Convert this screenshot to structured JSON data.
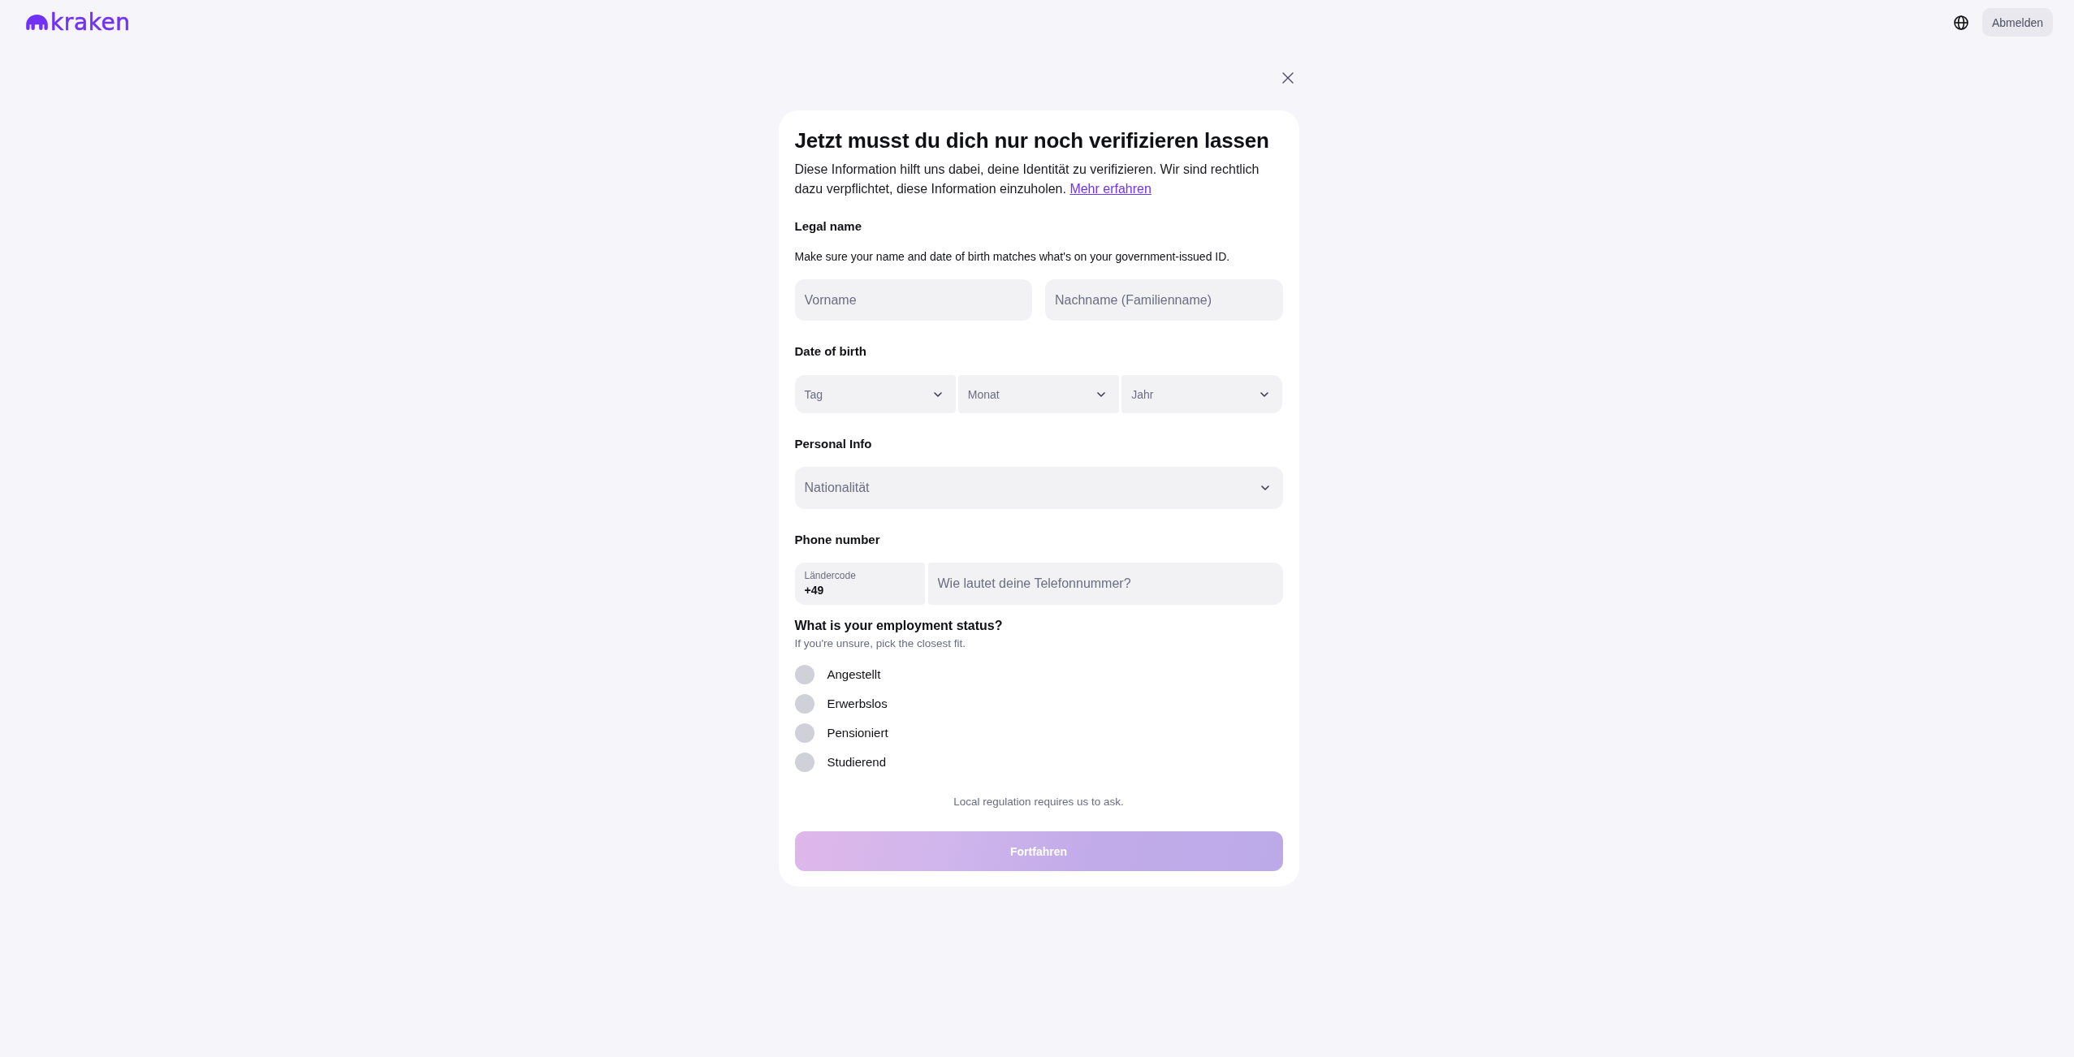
{
  "header": {
    "logo": "kraken",
    "logout_button": "Abmelden"
  },
  "card": {
    "title": "Jetzt musst du dich nur noch verifizieren lassen",
    "description": "Diese Information hilft uns dabei, deine Identität zu verifizieren. Wir sind rechtlich dazu verpflichtet, diese Information einzuholen.",
    "learn_more_link": "Mehr erfahren",
    "legal_name": {
      "heading": "Legal name",
      "hint": "Make sure your name and date of birth matches what's on your government-issued ID.",
      "fields": [
        {
          "placeholder": "Vorname"
        },
        {
          "placeholder": "Nachname (Familienname)"
        }
      ]
    },
    "date_of_birth": {
      "heading": "Date of birth",
      "selects": [
        {
          "placeholder": "Tag"
        },
        {
          "placeholder": "Monat"
        },
        {
          "placeholder": "Jahr"
        }
      ]
    },
    "personal_info": {
      "heading": "Personal Info",
      "nationality": {
        "placeholder": "Nationalität"
      }
    },
    "phone_number": {
      "heading": "Phone number",
      "country_code": {
        "label": "Ländercode",
        "value": "+49"
      },
      "number": {
        "placeholder": "Wie lautet deine Telefonnummer?"
      }
    },
    "employment_status": {
      "question": "What is your employment status?",
      "hint": "If you're unsure, pick the closest fit.",
      "options": [
        {
          "label": "Angestellt",
          "selected": false
        },
        {
          "label": "Erwerbslos",
          "selected": false
        },
        {
          "label": "Pensioniert",
          "selected": false
        },
        {
          "label": "Studierend",
          "selected": false
        }
      ]
    },
    "regulation_note": "Local regulation requires us to ask.",
    "continue_button": {
      "label": "Fortfahren",
      "disabled": true
    }
  }
}
